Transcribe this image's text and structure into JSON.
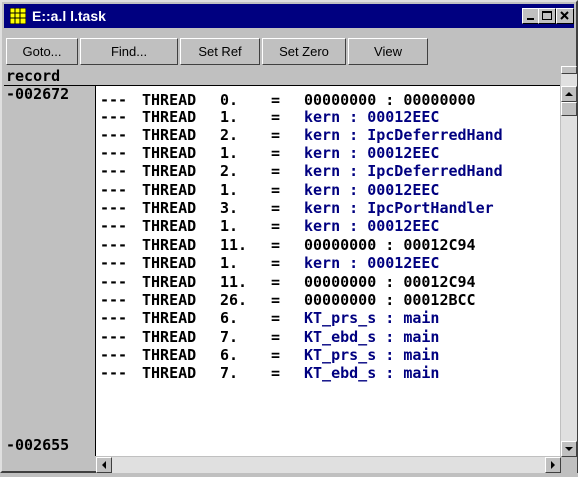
{
  "window": {
    "title": "E::a.l l.task"
  },
  "toolbar": {
    "buttons": [
      {
        "label": "Goto..."
      },
      {
        "label": "Find..."
      },
      {
        "label": "Set Ref"
      },
      {
        "label": "Set Zero"
      },
      {
        "label": "View"
      }
    ]
  },
  "header": {
    "record_label": "record"
  },
  "records": {
    "top": "-002672",
    "bottom": "-002655"
  },
  "rows": [
    {
      "dash": "---",
      "kind": "THREAD",
      "num": "0.",
      "eq": "=",
      "val": "00000000 : 00000000",
      "color": "#000000"
    },
    {
      "dash": "---",
      "kind": "THREAD",
      "num": "1.",
      "eq": "=",
      "val": "kern : 00012EEC",
      "color": "#000080"
    },
    {
      "dash": "---",
      "kind": "THREAD",
      "num": "2.",
      "eq": "=",
      "val": "kern : IpcDeferredHand",
      "color": "#000080"
    },
    {
      "dash": "---",
      "kind": "THREAD",
      "num": "1.",
      "eq": "=",
      "val": "kern : 00012EEC",
      "color": "#000080"
    },
    {
      "dash": "---",
      "kind": "THREAD",
      "num": "2.",
      "eq": "=",
      "val": "kern : IpcDeferredHand",
      "color": "#000080"
    },
    {
      "dash": "---",
      "kind": "THREAD",
      "num": "1.",
      "eq": "=",
      "val": "kern : 00012EEC",
      "color": "#000080"
    },
    {
      "dash": "---",
      "kind": "THREAD",
      "num": "3.",
      "eq": "=",
      "val": "kern : IpcPortHandler",
      "color": "#000080"
    },
    {
      "dash": "---",
      "kind": "THREAD",
      "num": "1.",
      "eq": "=",
      "val": "kern : 00012EEC",
      "color": "#000080"
    },
    {
      "dash": "---",
      "kind": "THREAD",
      "num": "11.",
      "eq": "=",
      "val": "00000000 : 00012C94",
      "color": "#000000"
    },
    {
      "dash": "---",
      "kind": "THREAD",
      "num": "1.",
      "eq": "=",
      "val": "kern : 00012EEC",
      "color": "#000080"
    },
    {
      "dash": "---",
      "kind": "THREAD",
      "num": "11.",
      "eq": "=",
      "val": "00000000 : 00012C94",
      "color": "#000000"
    },
    {
      "dash": "---",
      "kind": "THREAD",
      "num": "26.",
      "eq": "=",
      "val": "00000000 : 00012BCC",
      "color": "#000000"
    },
    {
      "dash": "---",
      "kind": "THREAD",
      "num": "6.",
      "eq": "=",
      "val": "KT_prs_s : main",
      "color": "#000080"
    },
    {
      "dash": "---",
      "kind": "THREAD",
      "num": "7.",
      "eq": "=",
      "val": "KT_ebd_s : main",
      "color": "#000080"
    },
    {
      "dash": "---",
      "kind": "THREAD",
      "num": "6.",
      "eq": "=",
      "val": "KT_prs_s : main",
      "color": "#000080"
    },
    {
      "dash": "---",
      "kind": "THREAD",
      "num": "7.",
      "eq": "=",
      "val": "KT_ebd_s : main",
      "color": "#000080"
    }
  ],
  "icons": {
    "app": "app-grid-icon",
    "minimize": "minimize-icon",
    "maximize": "maximize-icon",
    "close": "close-icon",
    "scroll_up": "scroll-up-arrow-icon",
    "scroll_down": "scroll-down-arrow-icon",
    "scroll_left": "scroll-left-arrow-icon",
    "scroll_right": "scroll-right-arrow-icon"
  },
  "colors": {
    "titlebar": "#000080",
    "value_blue": "#000080",
    "face": "#c0c0c0"
  }
}
